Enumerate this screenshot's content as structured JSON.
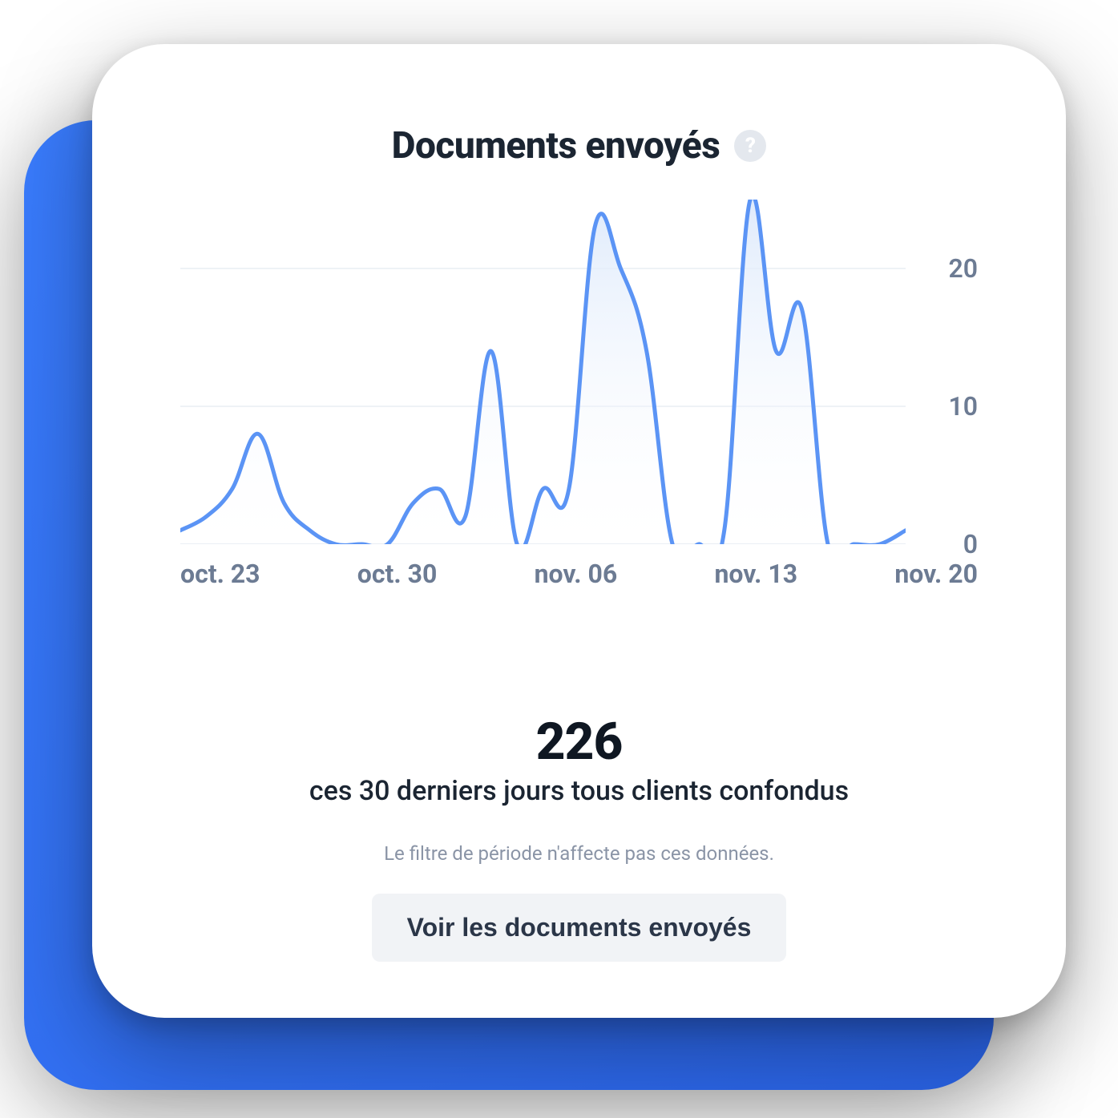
{
  "card": {
    "title": "Documents envoyés",
    "help_tooltip": "?"
  },
  "summary": {
    "value": "226",
    "subtitle": "ces 30 derniers jours tous clients confondus",
    "note": "Le filtre de période n'affecte pas ces données.",
    "cta_label": "Voir les documents envoyés"
  },
  "colors": {
    "line": "#5b94f5",
    "area_top": "#dbe8fb",
    "area_bottom": "#ffffff",
    "grid": "#e9edf3",
    "accent_bg": "#3a7dff"
  },
  "chart_data": {
    "type": "area",
    "title": "Documents envoyés",
    "xlabel": "",
    "ylabel": "",
    "ylim": [
      0,
      25
    ],
    "y_ticks": [
      0,
      10,
      20
    ],
    "x_tick_labels": [
      "oct. 23",
      "oct. 30",
      "nov. 06",
      "nov. 13",
      "nov. 20"
    ],
    "x": [
      0,
      1,
      2,
      3,
      4,
      5,
      6,
      7,
      8,
      9,
      10,
      11,
      12,
      13,
      14,
      15,
      16,
      17,
      18,
      19,
      20,
      21,
      22,
      23,
      24,
      25,
      26,
      27,
      28
    ],
    "values": [
      1,
      2,
      4,
      8,
      3,
      1,
      0,
      0,
      0,
      3,
      4,
      2,
      14,
      0,
      4,
      4,
      23,
      20,
      14,
      0,
      0,
      1,
      25,
      14,
      17,
      0,
      0,
      0,
      1
    ],
    "series": [
      {
        "name": "Documents envoyés",
        "values": [
          1,
          2,
          4,
          8,
          3,
          1,
          0,
          0,
          0,
          3,
          4,
          2,
          14,
          0,
          4,
          4,
          23,
          20,
          14,
          0,
          0,
          1,
          25,
          14,
          17,
          0,
          0,
          0,
          1
        ]
      }
    ]
  }
}
